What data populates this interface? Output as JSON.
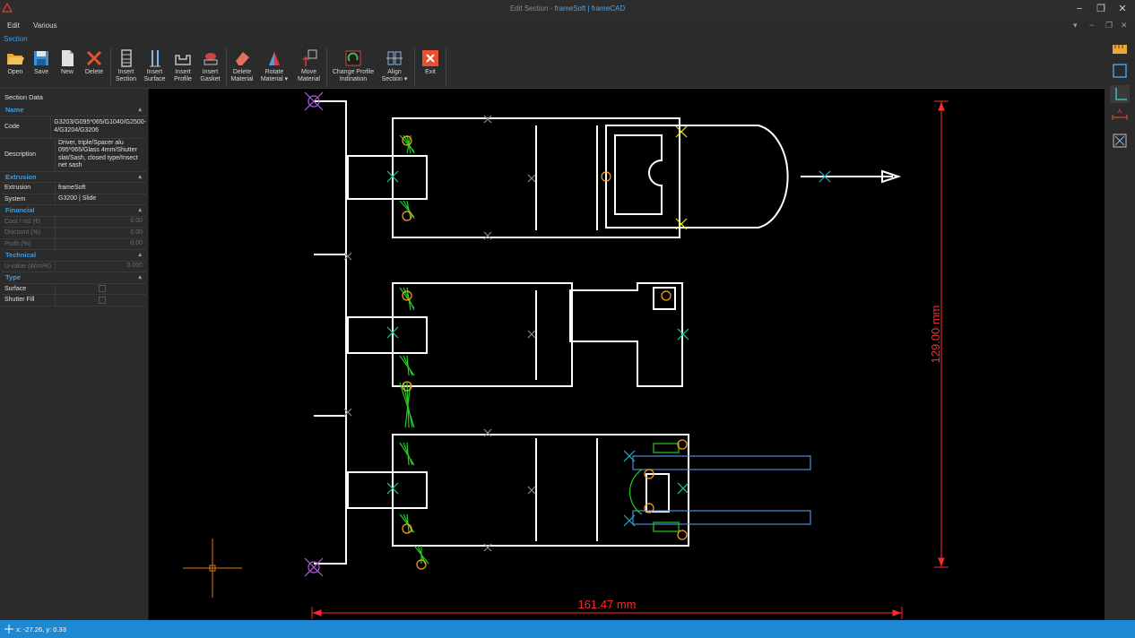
{
  "window": {
    "title_prefix": "Edit Section - ",
    "title_brand": "frameSoft | frameCAD",
    "minimize": "−",
    "maximize": "❐",
    "close": "✕"
  },
  "menu": {
    "items": [
      "Edit",
      "Various"
    ]
  },
  "ribbon": {
    "tab": "Section",
    "buttons": {
      "open": "Open",
      "save": "Save",
      "new": "New",
      "delete": "Delete",
      "insert_section_1": "Insert",
      "insert_section_2": "Section",
      "insert_surface_1": "Insert",
      "insert_surface_2": "Surface",
      "insert_profile_1": "Insert",
      "insert_profile_2": "Profile",
      "insert_gasket_1": "Insert",
      "insert_gasket_2": "Gasket",
      "delete_material_1": "Delete",
      "delete_material_2": "Material",
      "rotate_material_1": "Rotate",
      "rotate_material_2": "Material ▾",
      "move_material_1": "Move",
      "move_material_2": "Material",
      "change_profile_1": "Change Profile",
      "change_profile_2": "Indination",
      "align_section_1": "Align",
      "align_section_2": "Section ▾",
      "exit": "Exit"
    }
  },
  "panel": {
    "title": "Section Data",
    "cats": {
      "name": "Name",
      "extrusion": "Extrusion",
      "financial": "Financial",
      "technical": "Technical",
      "type": "Type"
    },
    "rows": {
      "code_key": "Code",
      "code_val": "G3203/G095*065/G1040/G2500-4/G3204/G3206",
      "desc_key": "Description",
      "desc_val": "Driver, triple/Spacer alu 095*065/Glass 4mm/Shutter slat/Sash, closed type/Insect net sash",
      "extrusion_key": "Extrusion",
      "extrusion_val": "frameSoft",
      "system_key": "System",
      "system_val": "G3200 | Slide",
      "cost_key": "Cost / m2 (€)",
      "cost_val": "0.00",
      "discount_key": "Discount (%)",
      "discount_val": "0.00",
      "profit_key": "Profit (%)",
      "profit_val": "0.00",
      "uvalue_key": "U-value (W/m²K)",
      "uvalue_val": "0.000",
      "surface_key": "Surface",
      "shutter_key": "Shutter Fill"
    }
  },
  "drawing": {
    "dim_width": "161.47 mm",
    "dim_height": "129.00 mm",
    "dim_color": "#ff2a2a",
    "profile_color": "#ffffff",
    "gasket_color": "#22cc22"
  },
  "status": {
    "coords": "x: -27.26, y: 0.33"
  }
}
